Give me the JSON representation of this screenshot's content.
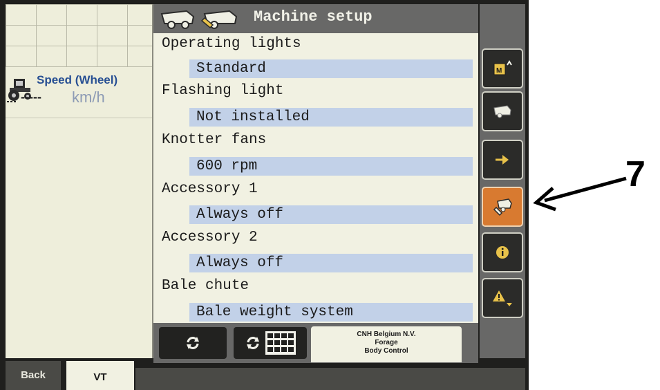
{
  "speed_widget": {
    "title": "Speed (Wheel)",
    "value": "-----",
    "unit": "km/h"
  },
  "panel": {
    "title": "Machine setup",
    "settings": [
      {
        "label": "Operating lights",
        "value": "Standard"
      },
      {
        "label": "Flashing light",
        "value": "Not installed"
      },
      {
        "label": "Knotter fans",
        "value": "600 rpm"
      },
      {
        "label": "Accessory 1",
        "value": "Always off"
      },
      {
        "label": "Accessory 2",
        "value": "Always off"
      },
      {
        "label": "Bale chute",
        "value": "Bale weight system"
      }
    ]
  },
  "credit": {
    "line1": "CNH Belgium N.V.",
    "line2": "Forage",
    "line3": "Body Control"
  },
  "softkeys": [
    {
      "icon": "memory-card-icon"
    },
    {
      "icon": "baler-icon"
    },
    {
      "icon": "arrow-right-icon"
    },
    {
      "icon": "wrench-baler-icon",
      "active": true
    },
    {
      "icon": "info-icon"
    },
    {
      "icon": "warning-icon"
    }
  ],
  "tabs": {
    "back": "Back",
    "vt": "VT"
  },
  "annotation": {
    "label": "7"
  },
  "colors": {
    "active_softkey": "#d87a30",
    "value_highlight": "#c2d1e8",
    "panel_bg": "#f1f1e2"
  }
}
